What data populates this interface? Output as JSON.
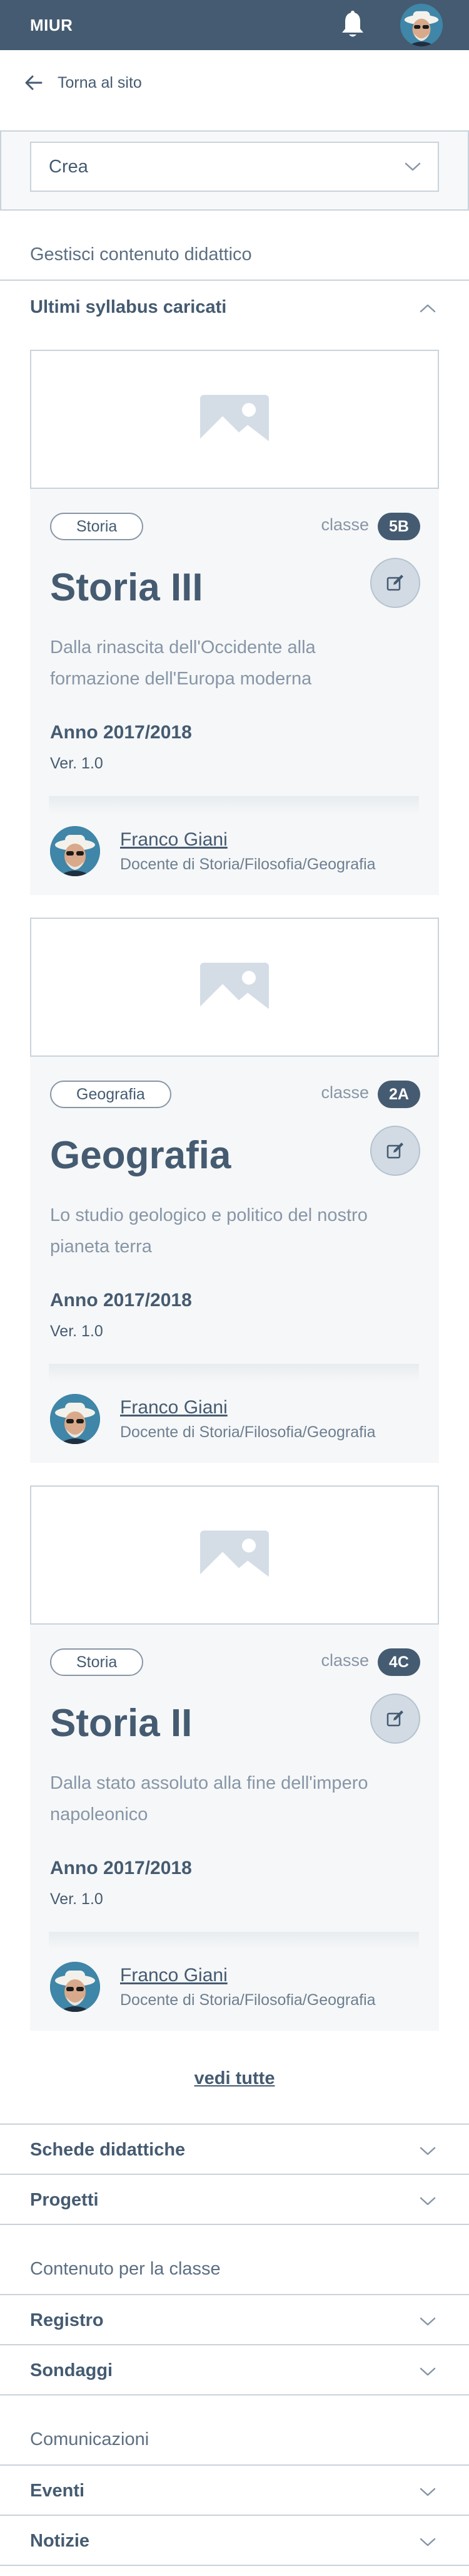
{
  "header": {
    "brand": "MIUR"
  },
  "back": {
    "label": "Torna al sito"
  },
  "crea": {
    "selected": "Crea"
  },
  "sections": [
    {
      "title": "Gestisci contenuto didattico"
    },
    {
      "title": "Contenuto per la classe"
    },
    {
      "title": "Comunicazioni"
    }
  ],
  "syllabus": {
    "title": "Ultimi syllabus caricati",
    "see_all": "vedi tutte",
    "classe_label": "classe",
    "cards": [
      {
        "tag": "Storia",
        "classe": "5B",
        "title": "Storia III",
        "description": "Dalla rinascita dell'Occidente alla formazione dell'Europa moderna",
        "year": "Anno 2017/2018",
        "version": "Ver. 1.0",
        "author": "Franco Giani",
        "role": "Docente di Storia/Filosofia/Geografia"
      },
      {
        "tag": "Geografia",
        "classe": "2A",
        "title": "Geografia",
        "description": "Lo studio geologico e politico del nostro pianeta terra",
        "year": "Anno 2017/2018",
        "version": "Ver. 1.0",
        "author": "Franco Giani",
        "role": "Docente di Storia/Filosofia/Geografia"
      },
      {
        "tag": "Storia",
        "classe": "4C",
        "title": "Storia II",
        "description": "Dalla stato assoluto alla fine dell'impero napoleonico",
        "year": "Anno 2017/2018",
        "version": "Ver. 1.0",
        "author": "Franco Giani",
        "role": "Docente di Storia/Filosofia/Geografia"
      }
    ]
  },
  "accordions": {
    "schede": "Schede didattiche",
    "progetti": "Progetti",
    "registro": "Registro",
    "sondaggi": "Sondaggi",
    "eventi": "Eventi",
    "notizie": "Notizie"
  },
  "icons": [
    "bell-icon",
    "avatar",
    "arrow-left-icon",
    "chevron-down-icon",
    "chevron-up-icon",
    "image-placeholder-icon",
    "edit-icon"
  ],
  "colors": {
    "primary": "#455b71",
    "border": "#c9d3dc",
    "card_bg": "#f6f7f8",
    "muted": "#8796a7"
  }
}
